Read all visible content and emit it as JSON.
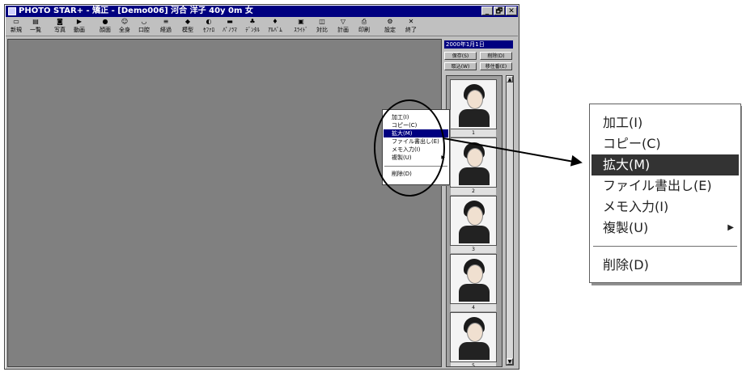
{
  "window": {
    "title": "PHOTO STAR+ - 矯正 - [Demo006]  河合  洋子  40y 0m  女",
    "controls": [
      "_",
      "🗗",
      "✕"
    ]
  },
  "toolbar": {
    "tools": [
      {
        "label": "新規",
        "icon": "new-icon"
      },
      {
        "label": "一覧",
        "icon": "list-icon"
      },
      {
        "label": "写真",
        "icon": "camera-icon"
      },
      {
        "label": "動画",
        "icon": "video-icon"
      },
      {
        "label": "顔面",
        "icon": "face-icon"
      },
      {
        "label": "全身",
        "icon": "body-icon"
      },
      {
        "label": "口腔",
        "icon": "mouth-icon"
      },
      {
        "label": "経過",
        "icon": "progress-icon"
      },
      {
        "label": "模型",
        "icon": "model-icon"
      },
      {
        "label": "ｾﾌｧﾛ",
        "icon": "cephalo-icon"
      },
      {
        "label": "ﾊﾟﾉﾗﾏ",
        "icon": "panorama-icon"
      },
      {
        "label": "ﾃﾞﾝﾀﾙ",
        "icon": "dental-icon"
      },
      {
        "label": "ｱﾙﾊﾞﾑ",
        "icon": "album-icon"
      },
      {
        "label": "ｽﾗｲﾄﾞ",
        "icon": "slide-icon"
      },
      {
        "label": "対比",
        "icon": "compare-icon"
      },
      {
        "label": "計画",
        "icon": "plan-icon"
      },
      {
        "label": "印刷",
        "icon": "print-icon"
      },
      {
        "label": "設定",
        "icon": "settings-icon"
      },
      {
        "label": "終了",
        "icon": "exit-icon"
      }
    ]
  },
  "side_panel": {
    "date": "2000年1月1日",
    "buttons": [
      "保存(S)",
      "削除(D)",
      "取込(W)",
      "移住番(E)"
    ],
    "thumbnails": [
      "1",
      "2",
      "3",
      "4",
      "5"
    ]
  },
  "context_menu": {
    "items": [
      {
        "label": "加工(I)",
        "selected": false,
        "submenu": false
      },
      {
        "label": "コピー(C)",
        "selected": false,
        "submenu": false
      },
      {
        "label": "拡大(M)",
        "selected": true,
        "submenu": false
      },
      {
        "label": "ファイル書出し(E)",
        "selected": false,
        "submenu": false
      },
      {
        "label": "メモ入力(I)",
        "selected": false,
        "submenu": false
      },
      {
        "label": "複製(U)",
        "selected": false,
        "submenu": true
      },
      {
        "label": "削除(D)",
        "selected": false,
        "submenu": false
      }
    ]
  },
  "colors": {
    "titlebar": "#000080",
    "workspace": "#808080",
    "selection_large": "#333333"
  }
}
